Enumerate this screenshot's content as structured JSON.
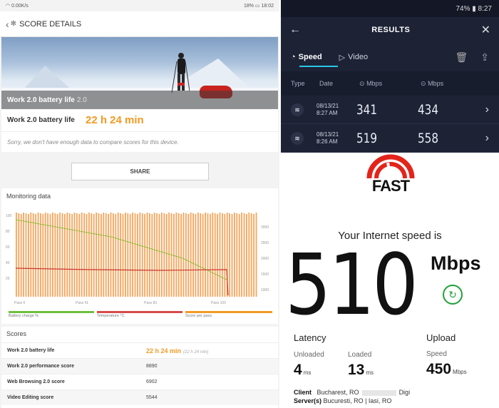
{
  "score_details": {
    "status": {
      "net_speed": "0.00K/s",
      "battery": "18%",
      "time": "18:02"
    },
    "header_title": "SCORE DETAILS",
    "hero_caption": "Work 2.0 battery life",
    "hero_caption_extra": "2.0",
    "score_label": "Work 2.0 battery life",
    "score_value": "22 h 24 min",
    "compare_note": "Sorry, we don't have enough data to compare scores for this device."
  },
  "results": {
    "status": {
      "battery": "74%",
      "time": "8:27"
    },
    "title": "RESULTS",
    "tabs": [
      {
        "label": "Speed"
      },
      {
        "label": "Video"
      }
    ],
    "columns": {
      "type": "Type",
      "date": "Date",
      "download": "Mbps",
      "upload": "Mbps"
    },
    "rows": [
      {
        "date": "08/13/21",
        "time": "8:27 AM",
        "download": "341",
        "upload": "434"
      },
      {
        "date": "08/13/21",
        "time": "8:26 AM",
        "download": "519",
        "upload": "558"
      }
    ]
  },
  "monitoring": {
    "share_label": "SHARE",
    "title": "Monitoring data",
    "y_left_ticks": [
      "100",
      "80",
      "60",
      "40",
      "20"
    ],
    "y_right_ticks": [
      "3000",
      "2500",
      "2000",
      "1500",
      "1000"
    ],
    "x_ticks": [
      "Pass 0",
      "Pass 41",
      "Pass 83",
      "Pass 100"
    ],
    "legend": [
      {
        "label": "Battery charge %",
        "color": "#6fbf3c"
      },
      {
        "label": "Temperature °C",
        "color": "#d84a4a"
      },
      {
        "label": "Score per pass",
        "color": "#f39a24"
      }
    ],
    "scores_title": "Scores",
    "scores": [
      {
        "name": "Work 2.0 battery life",
        "value": "22 h 24 min",
        "sub": "(22 h 24 min)"
      },
      {
        "name": "Work 2.0 performance score",
        "value": "8890",
        "sub": ""
      },
      {
        "name": "Web Browsing 2.0 score",
        "value": "6902",
        "sub": ""
      },
      {
        "name": "Video Editing score",
        "value": "5544",
        "sub": ""
      }
    ]
  },
  "fast": {
    "logo_text": "FAST",
    "headline": "Your Internet speed is",
    "speed": "510",
    "unit": "Mbps",
    "latency": {
      "title": "Latency",
      "unloaded_label": "Unloaded",
      "unloaded_value": "4",
      "loaded_label": "Loaded",
      "loaded_value": "13",
      "unit": "ms"
    },
    "upload": {
      "title": "Upload",
      "speed_label": "Speed",
      "value": "450",
      "unit": "Mbps"
    },
    "client": {
      "label": "Client",
      "location": "Bucharest, RO",
      "isp": "Digi"
    },
    "server": {
      "label": "Server(s)",
      "list": "Bucuresti, RO  |  Iasi, RO"
    }
  }
}
